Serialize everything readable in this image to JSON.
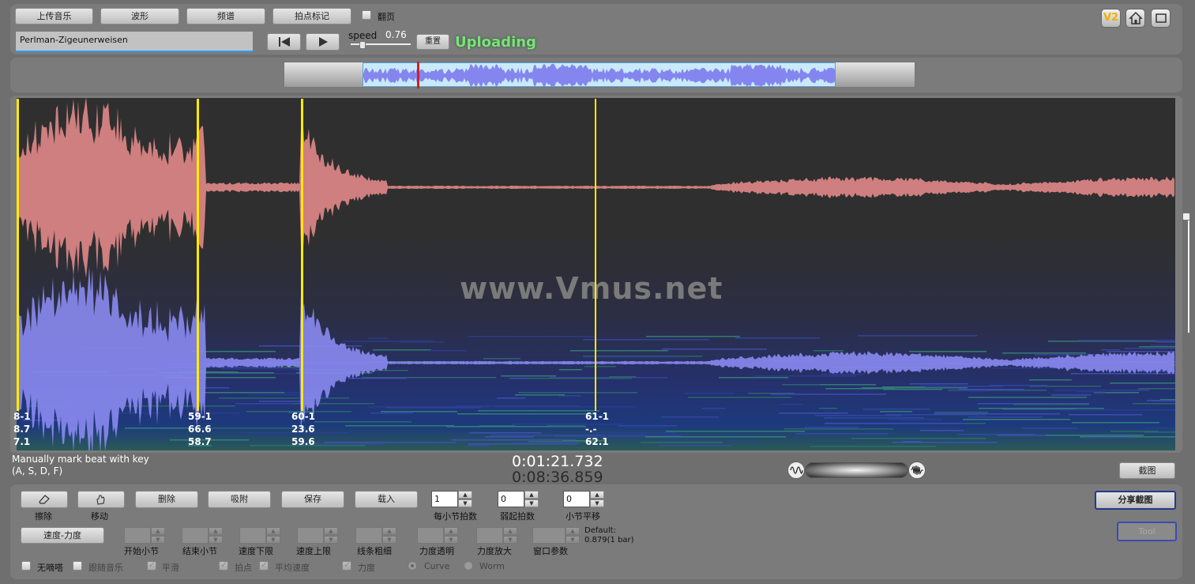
{
  "toolbar": {
    "upload_music": "上传音乐",
    "waveform": "波形",
    "spectrum": "频谱",
    "beat_marking": "拍点标记",
    "page_flip": "翻页",
    "song_name": "Perlman-Zigeunerweisen",
    "speed_label": "speed",
    "speed_value": "0.76",
    "reset_label": "重置",
    "status": "Uploading",
    "version_badge": "V2",
    "slider_fraction": 0.2
  },
  "watermark": "www.Vmus.net",
  "markers": [
    {
      "id": "58",
      "label": "8-1",
      "v1": "8.7",
      "v2": "7.1"
    },
    {
      "id": "59",
      "label": "59-1",
      "v1": "66.6",
      "v2": "58.7"
    },
    {
      "id": "60",
      "label": "60-1",
      "v1": "23.6",
      "v2": "59.6"
    },
    {
      "id": "61",
      "label": "61-1",
      "v1": "-.-",
      "v2": "62.1"
    }
  ],
  "hint": {
    "line1": "Manually mark beat with key",
    "line2": "(A, S, D, F)"
  },
  "time": {
    "current": "0:01:21.732",
    "total": "0:08:36.859"
  },
  "screenshot_label": "截图",
  "controls": {
    "erase": "擦除",
    "move": "移动",
    "delete": "删除",
    "snap": "吸附",
    "save": "保存",
    "load": "载入",
    "beats_per_bar_value": "1",
    "beats_per_bar_label": "每小节拍数",
    "pickup_beats_value": "0",
    "pickup_beats_label": "弱起拍数",
    "bar_shift_value": "0",
    "bar_shift_label": "小节平移",
    "share_screenshot": "分享截图",
    "tool_label": "Tool",
    "speed_dynamics": "速度-力度",
    "start_bar": "开始小节",
    "end_bar": "结束小节",
    "speed_min": "速度下限",
    "speed_max": "速度上限",
    "line_width": "线条粗细",
    "dyn_opacity": "力度透明",
    "dyn_scale": "力度放大",
    "window_param": "窗口参数",
    "default_label": "Default:",
    "default_value": "0.879(1 bar)",
    "no_beeps": "无嘀嗒",
    "follow_music": "跟随音乐",
    "smooth": "平滑",
    "beat_point": "拍点",
    "avg_speed": "平均速度",
    "dynamics": "力度",
    "curve": "Curve",
    "worm": "Worm"
  },
  "colors": {
    "waveform_top": "#cf7f7f",
    "waveform_bottom": "#8a8aef",
    "marker": "#ffeb00",
    "status": "#7ee07e",
    "canvas": "#2f2f2f"
  }
}
